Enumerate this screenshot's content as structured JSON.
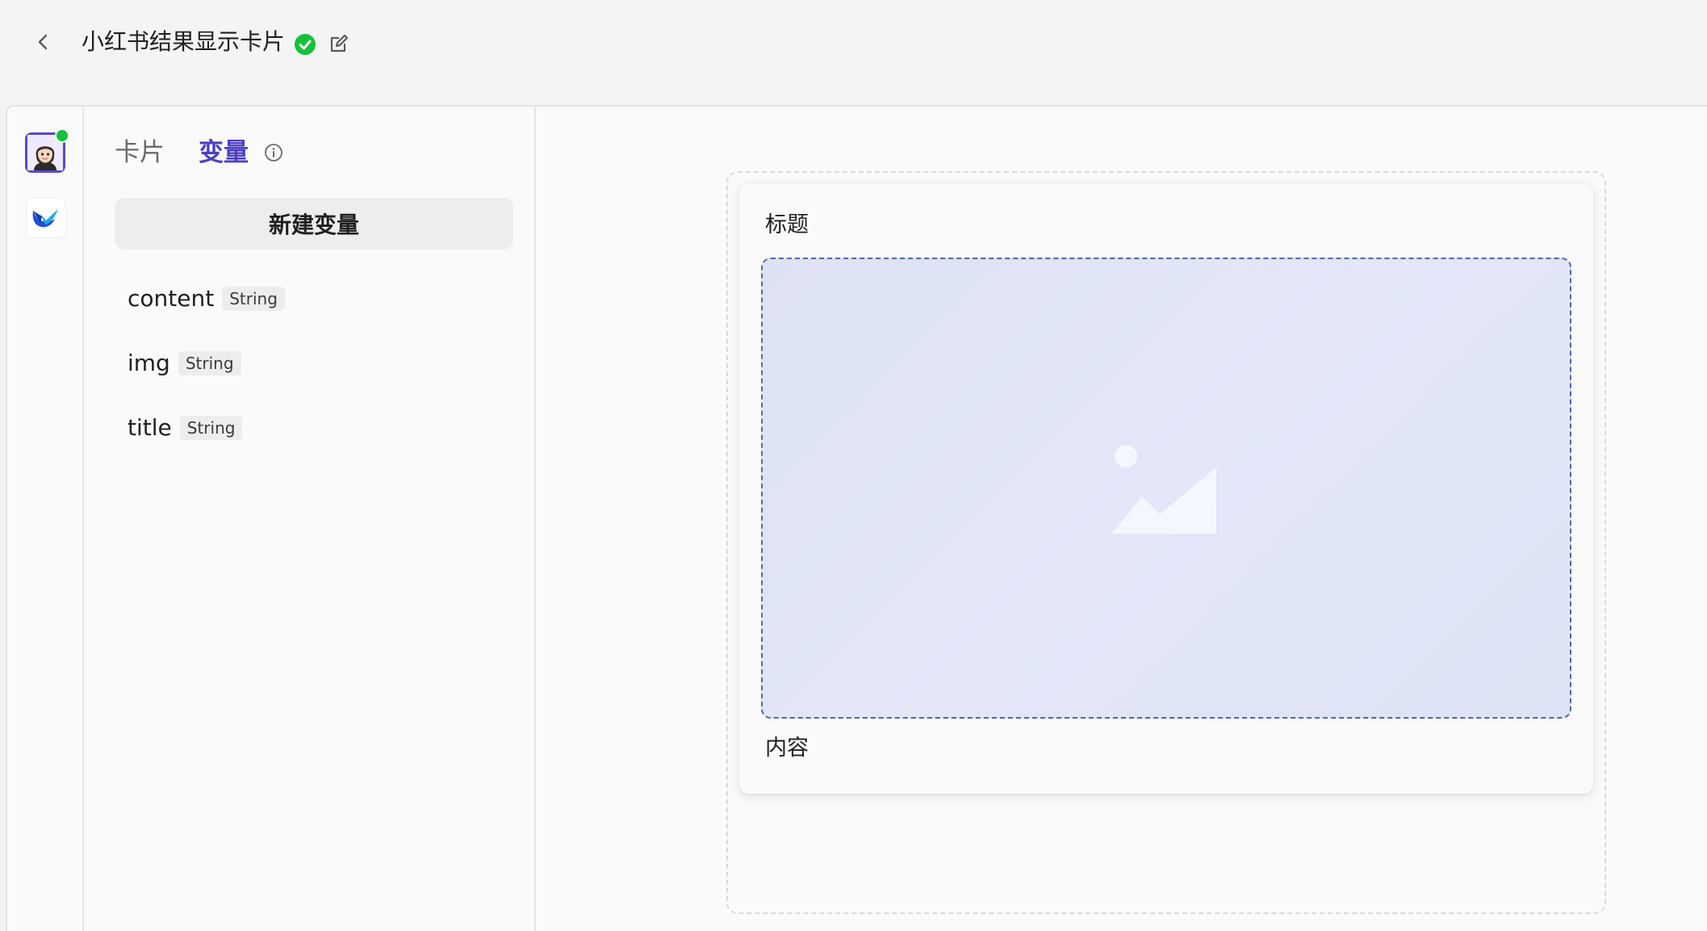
{
  "header": {
    "title": "小红书结果显示卡片",
    "status": "published",
    "status_color": "#13c23a"
  },
  "rail": {
    "items": [
      {
        "name": "avatar",
        "active": true,
        "online": true
      },
      {
        "name": "app-logo"
      }
    ]
  },
  "panel": {
    "tabs": [
      {
        "label": "卡片",
        "active": false
      },
      {
        "label": "变量",
        "active": true
      }
    ],
    "new_variable_label": "新建变量",
    "variables": [
      {
        "name": "content",
        "type": "String"
      },
      {
        "name": "img",
        "type": "String"
      },
      {
        "name": "title",
        "type": "String"
      }
    ]
  },
  "card": {
    "title": "标题",
    "content": "内容"
  },
  "colors": {
    "accent": "#4b3fc4",
    "image_border": "#4a6ba8",
    "image_fill": "#e1e6f6"
  }
}
